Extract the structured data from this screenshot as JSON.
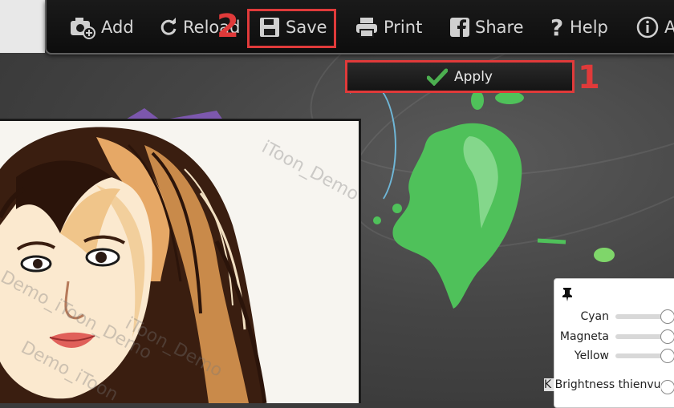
{
  "toolbar": {
    "add": "Add",
    "reload": "Reload",
    "save": "Save",
    "print": "Print",
    "share": "Share",
    "help": "Help",
    "about": "A"
  },
  "apply_label": "Apply",
  "steps": {
    "one": "1",
    "two": "2"
  },
  "watermarks": [
    "Demo_iToon_Demo",
    "iToon_Demo",
    "Demo_iToon",
    "iToon_Demo"
  ],
  "color_panel": {
    "sliders": [
      {
        "label": "Cyan",
        "value": 1.0
      },
      {
        "label": "Magneta",
        "value": 1.0
      },
      {
        "label": "Yellow",
        "value": 1.0
      }
    ],
    "brightness_label": "Brightness"
  },
  "caption": "K Brightness  thienvu",
  "colors": {
    "highlight": "#e03a3a",
    "paint_green": "#4fc15a",
    "check_green": "#4caf50"
  },
  "icons": [
    "camera-plus-icon",
    "reload-icon",
    "floppy-disk-icon",
    "printer-icon",
    "facebook-icon",
    "question-icon",
    "info-icon",
    "check-icon",
    "pin-icon"
  ]
}
